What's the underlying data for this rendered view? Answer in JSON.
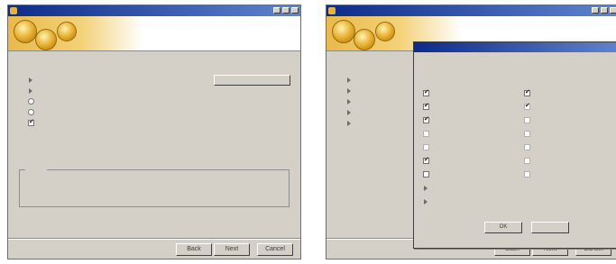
{
  "left_window": {
    "title": "",
    "banner": {
      "heading": "",
      "subheading": "",
      "subheading2": ""
    },
    "options": [
      {
        "icon": "arrow-icon",
        "label": "",
        "size": "",
        "checked": false
      },
      {
        "icon": "arrow-icon",
        "label": "",
        "size": "",
        "checked": false
      },
      {
        "icon": "radio-icon",
        "label": "",
        "size": "",
        "checked": false
      },
      {
        "icon": "radio-icon",
        "label": "",
        "size": "",
        "checked": false
      },
      {
        "icon": "checkbox-icon",
        "label": "",
        "size": "",
        "checked": true
      }
    ],
    "inline_button": "",
    "group": {
      "legend": "",
      "description": ""
    },
    "space_required": {
      "label": "",
      "value": ""
    },
    "space_available": {
      "label": "",
      "value": ""
    },
    "buttons": {
      "back": "Back",
      "next": "Next",
      "cancel": "Cancel"
    }
  },
  "right_window": {
    "title": "",
    "banner": {
      "heading": "",
      "subheading": ""
    },
    "options": [
      {
        "label": ""
      },
      {
        "label": ""
      },
      {
        "label": ""
      },
      {
        "label": ""
      },
      {
        "label": ""
      }
    ],
    "buttons": {
      "back": "Back",
      "next": "Next",
      "cancel": "Cancel"
    },
    "dialog": {
      "title": "",
      "heading": "",
      "subheading": "",
      "subheading2": "",
      "left_items": [
        {
          "label": "",
          "checked": true,
          "enabled": true,
          "kind": "checkbox"
        },
        {
          "label": "",
          "checked": true,
          "enabled": true,
          "kind": "checkbox"
        },
        {
          "label": "",
          "checked": true,
          "enabled": true,
          "kind": "checkbox"
        },
        {
          "label": "",
          "checked": false,
          "enabled": false,
          "kind": "checkbox"
        },
        {
          "label": "",
          "checked": false,
          "enabled": false,
          "kind": "checkbox"
        },
        {
          "label": "",
          "checked": true,
          "enabled": true,
          "kind": "checkbox"
        },
        {
          "label": "",
          "checked": false,
          "enabled": true,
          "kind": "checkbox"
        },
        {
          "label": "",
          "checked": false,
          "enabled": true,
          "kind": "arrow"
        },
        {
          "label": "",
          "checked": false,
          "enabled": true,
          "kind": "arrow"
        }
      ],
      "right_items": [
        {
          "label": "",
          "checked": true,
          "enabled": true
        },
        {
          "label": "",
          "checked": true,
          "enabled": false
        },
        {
          "label": "",
          "checked": false,
          "enabled": false
        },
        {
          "label": "",
          "checked": false,
          "enabled": false
        },
        {
          "label": "",
          "checked": false,
          "enabled": false
        },
        {
          "label": "",
          "checked": false,
          "enabled": false
        },
        {
          "label": "",
          "checked": false,
          "enabled": false
        }
      ],
      "ok_label": "OK",
      "cancel_label": ""
    }
  }
}
